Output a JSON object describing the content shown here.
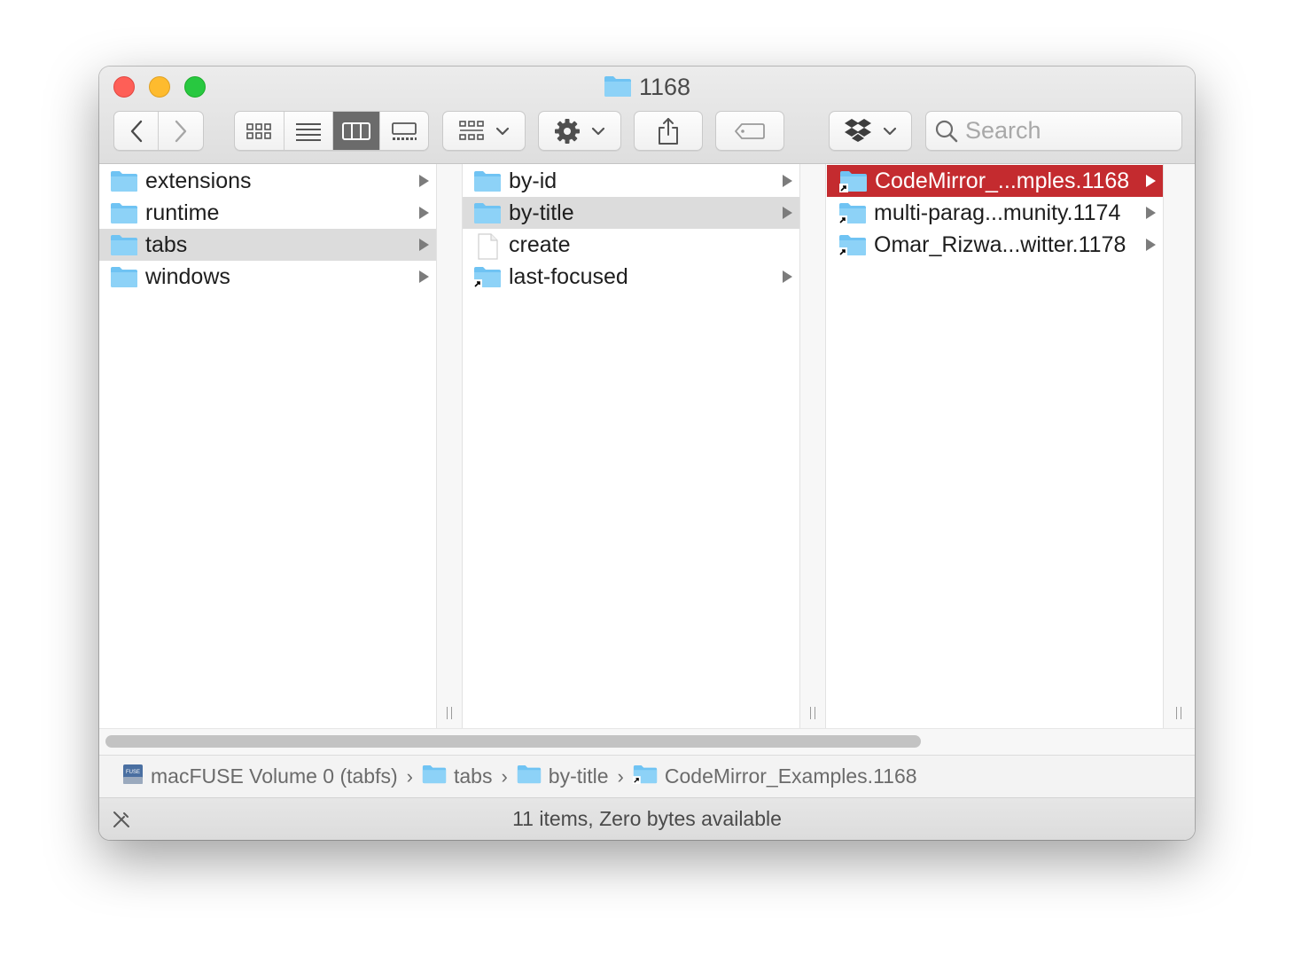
{
  "window": {
    "title": "1168"
  },
  "toolbar": {
    "search_placeholder": "Search",
    "view_modes": [
      "icon-view",
      "list-view",
      "column-view",
      "gallery-view"
    ],
    "active_view": "column-view"
  },
  "columns": [
    {
      "items": [
        {
          "name": "extensions",
          "type": "folder",
          "has_children": true,
          "selected": false
        },
        {
          "name": "runtime",
          "type": "folder",
          "has_children": true,
          "selected": false
        },
        {
          "name": "tabs",
          "type": "folder",
          "has_children": true,
          "selected": true
        },
        {
          "name": "windows",
          "type": "folder",
          "has_children": true,
          "selected": false
        }
      ]
    },
    {
      "items": [
        {
          "name": "by-id",
          "type": "folder",
          "has_children": true,
          "selected": false
        },
        {
          "name": "by-title",
          "type": "folder",
          "has_children": true,
          "selected": true
        },
        {
          "name": "create",
          "type": "file",
          "has_children": false,
          "selected": false
        },
        {
          "name": "last-focused",
          "type": "alias-folder",
          "has_children": true,
          "selected": false
        }
      ]
    },
    {
      "items": [
        {
          "name": "CodeMirror_...mples.1168",
          "type": "alias-folder",
          "has_children": true,
          "selected": true
        },
        {
          "name": "multi-parag...munity.1174",
          "type": "alias-folder",
          "has_children": true,
          "selected": false
        },
        {
          "name": "Omar_Rizwa...witter.1178",
          "type": "alias-folder",
          "has_children": true,
          "selected": false
        }
      ]
    }
  ],
  "path_bar": [
    {
      "label": "macFUSE Volume 0 (tabfs)",
      "icon": "drive-icon"
    },
    {
      "label": "tabs",
      "icon": "folder-icon"
    },
    {
      "label": "by-title",
      "icon": "folder-icon"
    },
    {
      "label": "CodeMirror_Examples.1168",
      "icon": "alias-folder-icon"
    }
  ],
  "status": {
    "text": "11 items, Zero bytes available"
  },
  "colors": {
    "selection_active": "#c42b2f",
    "selection_inactive": "#dcdcdc",
    "folder": "#6fc3f3"
  }
}
